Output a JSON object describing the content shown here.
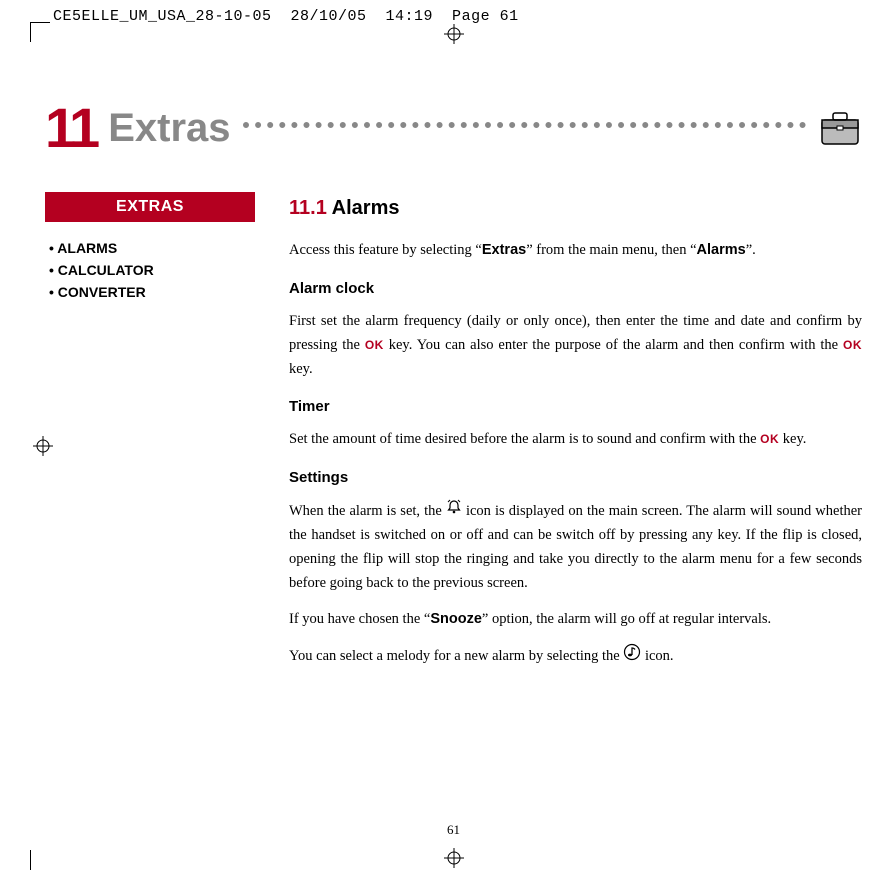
{
  "slug": "CE5ELLE_UM_USA_28-10-05  28/10/05  14:19  Page 61",
  "chapter": {
    "number": "11",
    "title": "Extras"
  },
  "sidebar": {
    "header": "EXTRAS",
    "items": [
      "ALARMS",
      "CALCULATOR",
      "CONVERTER"
    ]
  },
  "section": {
    "number": "11.1",
    "title": "Alarms",
    "intro_a": "Access this feature by selecting “",
    "intro_b": "” from the main menu, then “",
    "intro_c": "”.",
    "intro_extras": "Extras",
    "intro_alarms": "Alarms",
    "alarm_clock_head": "Alarm clock",
    "alarm_clock_a": "First set the alarm frequency (daily or only once), then enter the time and date and confirm by pressing the ",
    "alarm_clock_b": " key. You can also enter the purpose of the alarm and then confirm with the ",
    "alarm_clock_c": " key.",
    "timer_head": "Timer",
    "timer_a": "Set the amount of time desired before the alarm is to sound and confirm with the ",
    "timer_b": " key.",
    "settings_head": "Settings",
    "settings_a": "When the alarm is set, the ",
    "settings_b": " icon is displayed on the main screen. The alarm will sound whether the handset is switched on or off and can be switch off by pressing any key. If the flip is closed, opening the flip will stop the ringing and take you directly to the alarm menu for a few seconds before going back to the previous screen.",
    "snooze_a": "If you have chosen the “",
    "snooze_word": "Snooze",
    "snooze_b": "” option, the alarm will go off at regular intervals.",
    "melody_a": "You can select a melody for a new alarm by selecting the ",
    "melody_b": " icon.",
    "ok_label": "OK"
  },
  "page_number": "61"
}
